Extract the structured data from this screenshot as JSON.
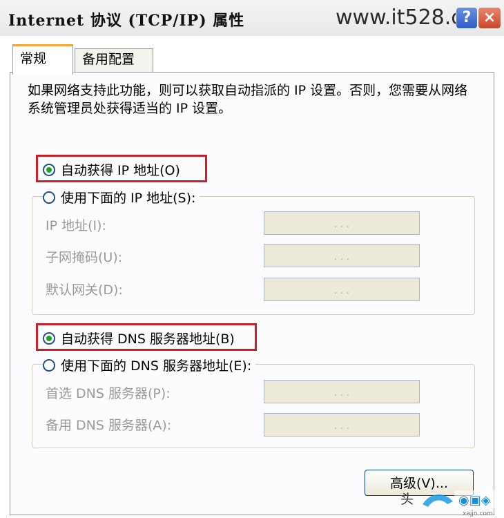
{
  "window": {
    "title": "Internet 协议 (TCP/IP) 属性",
    "watermark": "www.it528.com",
    "help_label": "?",
    "close_label": "×"
  },
  "tabs": [
    {
      "label": "常规",
      "active": true
    },
    {
      "label": "备用配置",
      "active": false
    }
  ],
  "description": "如果网络支持此功能，则可以获取自动指派的 IP 设置。否则，您需要从网络系统管理员处获得适当的 IP 设置。",
  "ip_section": {
    "auto_label": "自动获得 IP 地址(O)",
    "manual_label": "使用下面的 IP 地址(S):",
    "auto_selected": true,
    "fields": [
      {
        "label": "IP 地址(I):",
        "value": ". . ."
      },
      {
        "label": "子网掩码(U):",
        "value": ". . ."
      },
      {
        "label": "默认网关(D):",
        "value": ". . ."
      }
    ]
  },
  "dns_section": {
    "auto_label": "自动获得 DNS 服务器地址(B)",
    "manual_label": "使用下面的 DNS 服务器地址(E):",
    "auto_selected": true,
    "fields": [
      {
        "label": "首选 DNS 服务器(P):",
        "value": ". . ."
      },
      {
        "label": "备用 DNS 服务器(A):",
        "value": ". . ."
      }
    ]
  },
  "advanced_button": "高级(V)...",
  "overlay": {
    "source_prefix": "头",
    "site_logo": "xajjn.com"
  },
  "colors": {
    "highlight_box": "#c8202a",
    "radio_dot": "#21a121",
    "tab_accent": "#f2a73a"
  }
}
